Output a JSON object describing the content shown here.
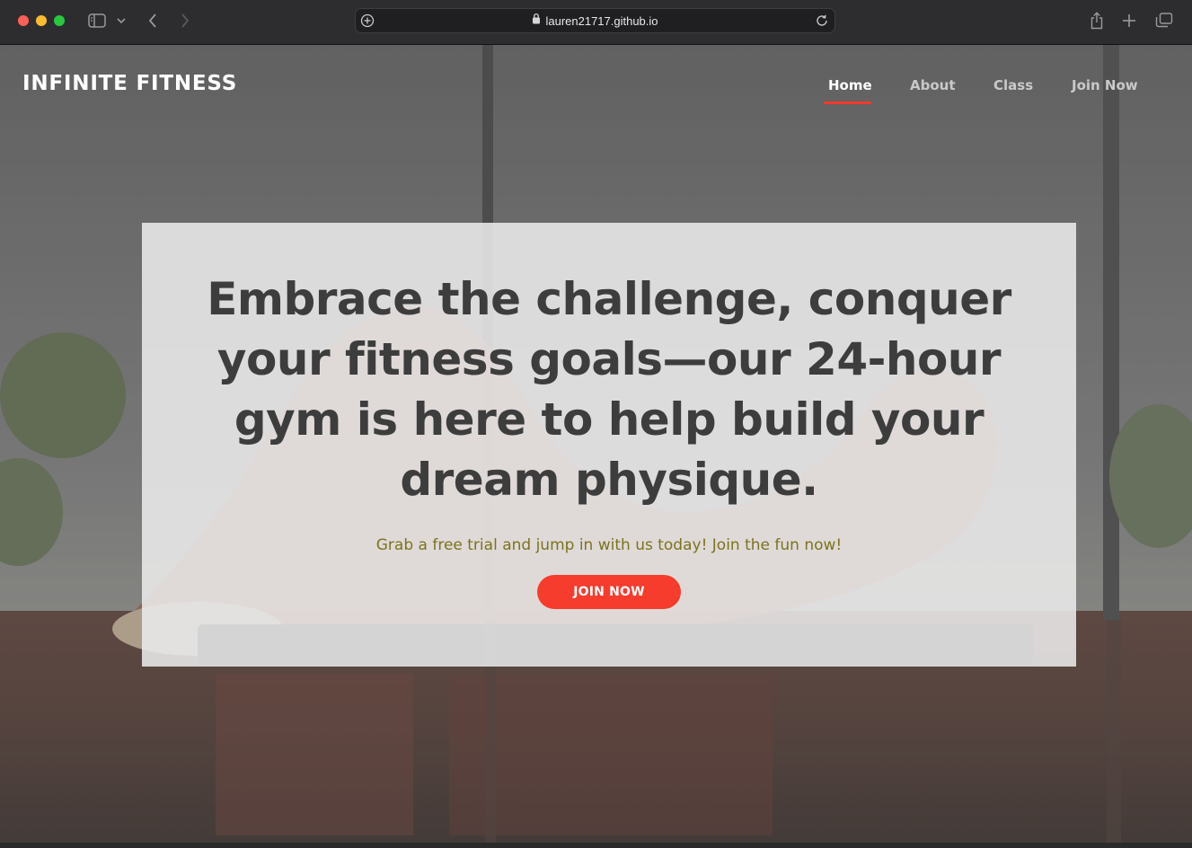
{
  "browser": {
    "url": "lauren21717.github.io",
    "icons": {
      "sidebar": "sidebar-icon",
      "back": "chevron-left-icon",
      "forward": "chevron-right-icon",
      "site_settings": "plus-circle-icon",
      "lock": "lock-icon",
      "reload": "reload-icon",
      "share": "share-icon",
      "new_tab": "plus-icon",
      "tab_overview": "tabs-icon"
    }
  },
  "site": {
    "brand": "INFINITE FITNESS",
    "nav": [
      {
        "label": "Home",
        "active": true
      },
      {
        "label": "About",
        "active": false
      },
      {
        "label": "Class",
        "active": false
      },
      {
        "label": "Join Now",
        "active": false
      }
    ]
  },
  "hero": {
    "title": "Embrace the challenge, conquer your fitness goals—our 24-hour gym is here to help build your dream physique.",
    "subtitle": "Grab a free trial and jump in with us today! Join the fun now!",
    "button": "JOIN NOW"
  },
  "colors": {
    "accent": "#f63c2c",
    "subtitle": "#7c731c",
    "title": "#3d3d3d"
  }
}
